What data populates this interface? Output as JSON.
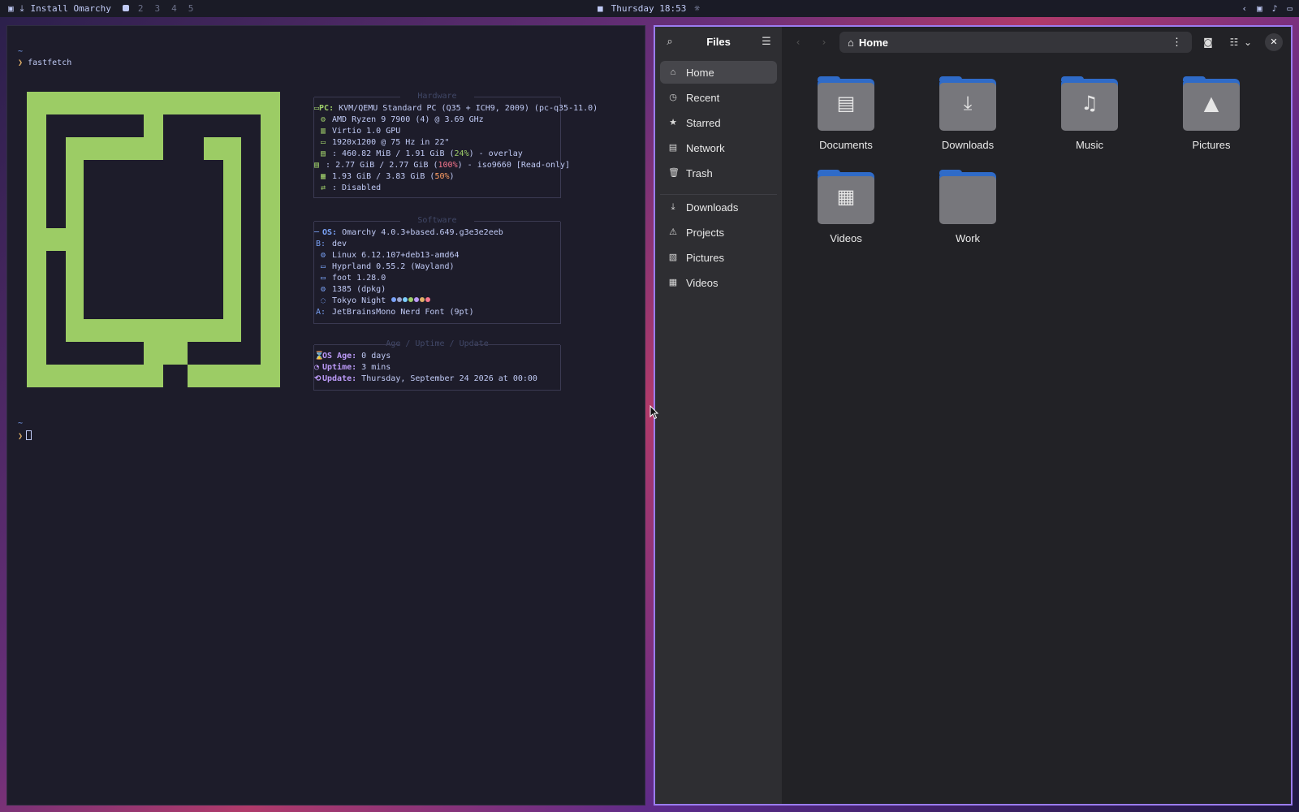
{
  "topbar": {
    "active_window_title": "Install Omarchy",
    "workspaces": [
      "2",
      "3",
      "4",
      "5"
    ],
    "clock": "Thursday 18:53"
  },
  "terminal": {
    "home_tilde": "~",
    "prompt_symbol": "❯",
    "command": "fastfetch",
    "hardware": {
      "title": "Hardware",
      "pc_key": "PC:",
      "pc_value": " KVM/QEMU Standard PC (Q35 + ICH9, 2009) (pc-q35-11.0)",
      "cpu": "AMD Ryzen 9 7900 (4) @ 3.69 GHz",
      "gpu": "Virtio 1.0 GPU",
      "display": "1920x1200 @ 75 Hz in 22\"",
      "disk1_a": "460.82 MiB / 1.91 GiB (",
      "disk1_pct": "24%",
      "disk1_b": ") - overlay",
      "disk2_a": "2.77 GiB / 2.77 GiB (",
      "disk2_pct": "100%",
      "disk2_b": ") - iso9660 [Read-only]",
      "mem_a": "1.93 GiB / 3.83 GiB (",
      "mem_pct": "50%",
      "mem_b": ")",
      "swap": ": Disabled"
    },
    "software": {
      "title": "Software",
      "os_key": "OS:",
      "os_value": " Omarchy 4.0.3+based.649.g3e3e2eeb",
      "host": "dev",
      "kernel": "Linux 6.12.107+deb13-amd64",
      "wm": "Hyprland 0.55.2 (Wayland)",
      "terminal": "foot 1.28.0",
      "packages": "1385 (dpkg)",
      "theme": "Tokyo Night",
      "font": "JetBrainsMono Nerd Font (9pt)"
    },
    "uptime": {
      "title": "Age / Uptime / Update",
      "age_key": "OS Age:",
      "age_value": " 0 days",
      "uptime_key": "Uptime:",
      "uptime_value": " 3 mins",
      "update_key": "Update:",
      "update_value": " Thursday, September 24 2026 at 00:00"
    },
    "theme_swatches": [
      "#7aa2f7",
      "#9aa5ce",
      "#7dcfff",
      "#9ece6a",
      "#bb9af7",
      "#e0af68",
      "#f7768e"
    ],
    "logo_color": "#9ccc65"
  },
  "files": {
    "title": "Files",
    "location": "Home",
    "sidebar": [
      {
        "label": "Home",
        "icon": "home-icon"
      },
      {
        "label": "Recent",
        "icon": "clock-icon"
      },
      {
        "label": "Starred",
        "icon": "star-icon"
      },
      {
        "label": "Network",
        "icon": "network-icon"
      },
      {
        "label": "Trash",
        "icon": "trash-icon"
      },
      {
        "label": "Downloads",
        "icon": "download-icon"
      },
      {
        "label": "Projects",
        "icon": "warning-icon"
      },
      {
        "label": "Pictures",
        "icon": "image-icon"
      },
      {
        "label": "Videos",
        "icon": "film-icon"
      }
    ],
    "items": [
      {
        "label": "Documents",
        "icon": "document-icon"
      },
      {
        "label": "Downloads",
        "icon": "download-icon"
      },
      {
        "label": "Music",
        "icon": "music-icon"
      },
      {
        "label": "Pictures",
        "icon": "image-icon"
      },
      {
        "label": "Videos",
        "icon": "film-icon"
      },
      {
        "label": "Work",
        "icon": "folder-icon"
      }
    ],
    "accent_color": "#9b7cf0"
  }
}
